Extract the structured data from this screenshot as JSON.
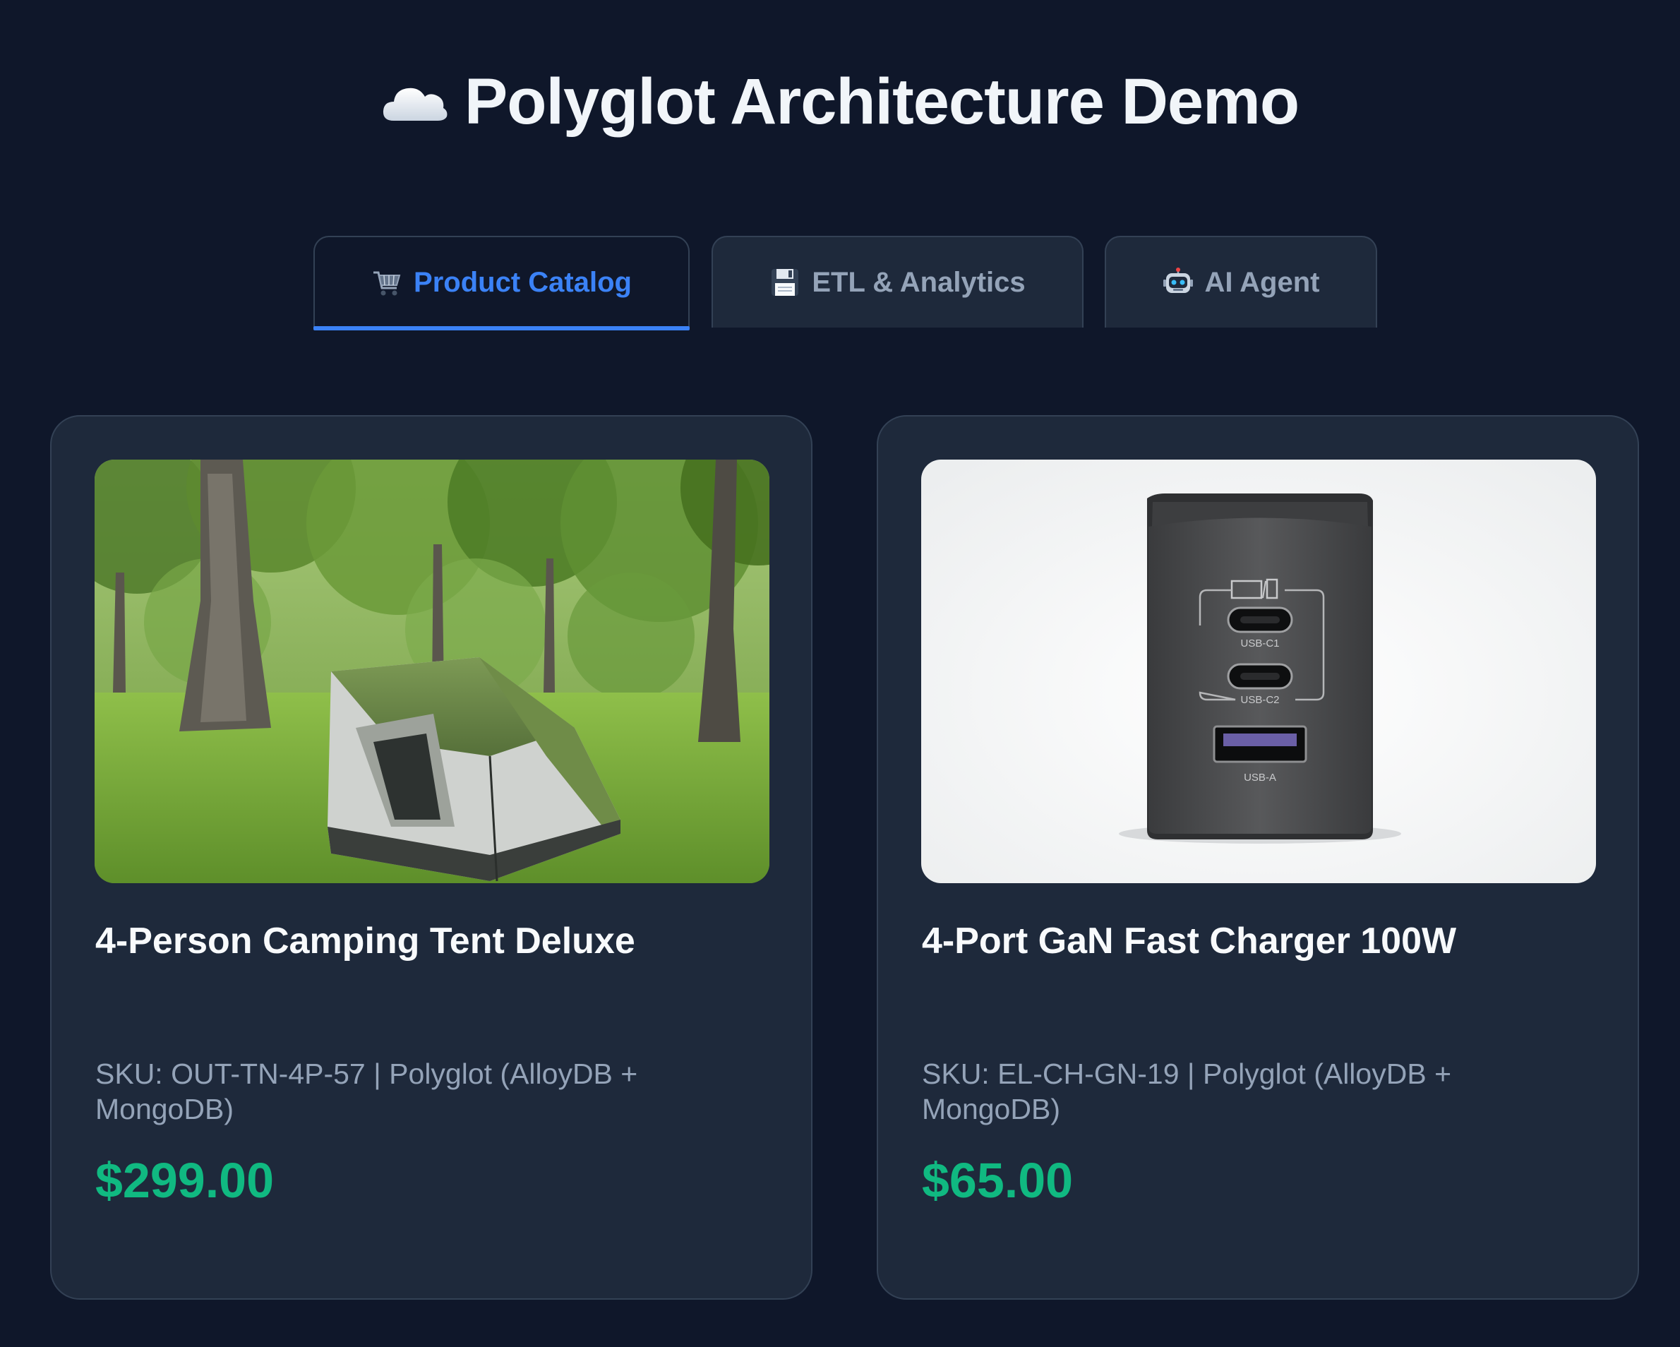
{
  "header": {
    "title": "Polyglot Architecture Demo",
    "icon": "cloud-icon"
  },
  "tabs": [
    {
      "label": "Product Catalog",
      "icon": "shopping-cart-icon",
      "active": true
    },
    {
      "label": "ETL & Analytics",
      "icon": "floppy-disk-icon",
      "active": false
    },
    {
      "label": "AI Agent",
      "icon": "robot-icon",
      "active": false
    }
  ],
  "products": [
    {
      "name": "4-Person Camping Tent Deluxe",
      "meta": "SKU: OUT-TN-4P-57 | Polyglot (AlloyDB + MongoDB)",
      "price": "$299.00",
      "image": "camping-tent-photo"
    },
    {
      "name": "4-Port GaN Fast Charger 100W",
      "meta": "SKU: EL-CH-GN-19 | Polyglot (AlloyDB + MongoDB)",
      "price": "$65.00",
      "image": "usb-charger-photo",
      "port_labels": [
        "USB-C1",
        "USB-C2",
        "USB-A"
      ]
    }
  ],
  "colors": {
    "background": "#0f172a",
    "card": "#1e293b",
    "accent": "#3b82f6",
    "price": "#10b981",
    "muted": "#94a3b8"
  }
}
